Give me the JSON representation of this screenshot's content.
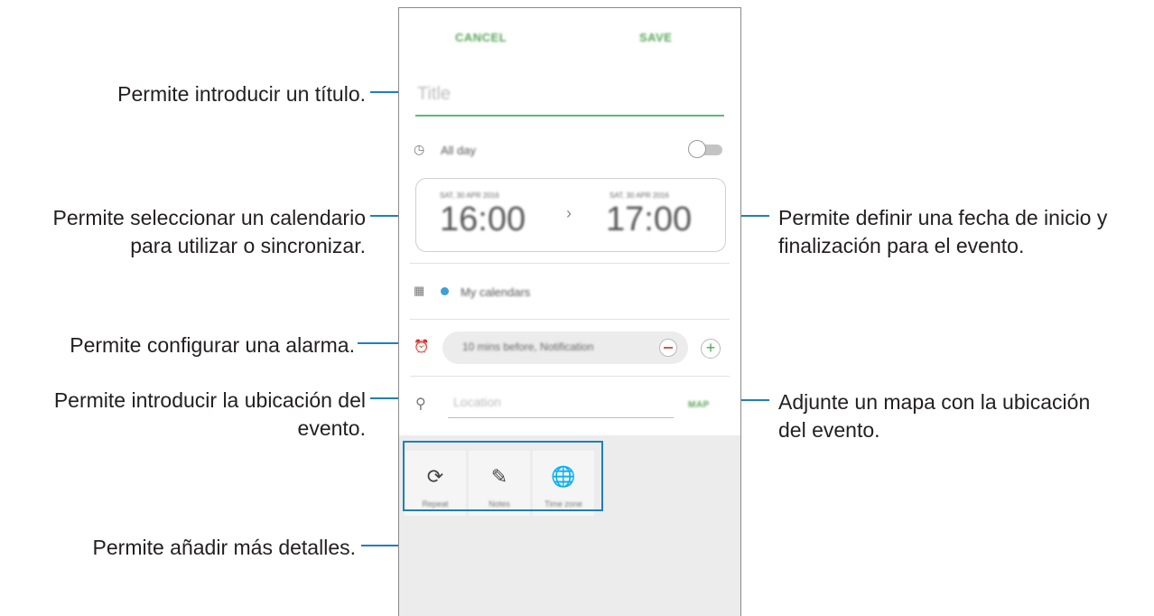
{
  "phone": {
    "cancel_label": "CANCEL",
    "save_label": "SAVE",
    "title_placeholder": "Title",
    "all_day_label": "All day",
    "start_date": "SAT, 30 APR 2016",
    "start_time": "16:00",
    "end_date": "SAT, 30 APR 2016",
    "end_time": "17:00",
    "calendar_label": "My calendars",
    "calendar_color": "#3aa0d5",
    "alarm_label": "10 mins before, Notification",
    "location_placeholder": "Location",
    "map_label": "MAP",
    "details": [
      {
        "label": "Repeat",
        "icon": "repeat-icon"
      },
      {
        "label": "Notes",
        "icon": "notes-icon"
      },
      {
        "label": "Time zone",
        "icon": "time-zone-icon"
      }
    ]
  },
  "annotations": {
    "title": "Permite introducir un título.",
    "calendar_line1": "Permite seleccionar un calendario",
    "calendar_line2": "para utilizar o sincronizar.",
    "alarm": "Permite configurar una alarma.",
    "location_line1": "Permite introducir la ubicación del",
    "location_line2": "evento.",
    "details": "Permite añadir más detalles.",
    "date_line1": "Permite definir una fecha de inicio y",
    "date_line2": "finalización para el evento.",
    "map_line1": "Adjunte un mapa con la ubicación",
    "map_line2": "del evento."
  },
  "colors": {
    "accent_line": "#1e7fc0",
    "title_underline": "#5bbb6f",
    "button_text": "#5aa35a"
  }
}
